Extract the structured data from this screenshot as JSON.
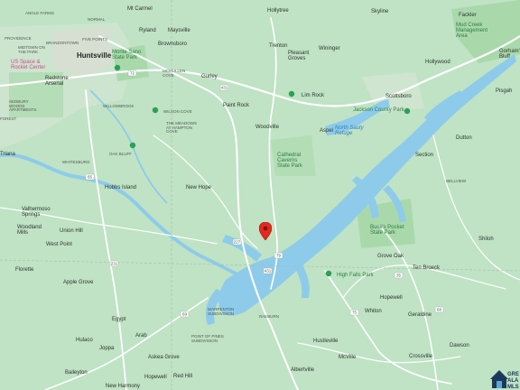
{
  "colors": {
    "land": "#bfe3c4",
    "land_light": "#cfead2",
    "water": "#8ecbea",
    "road": "#ffffff",
    "road_outline": "#9aa8a0",
    "park": "#a6d8a9",
    "urban": "#dcd6cc",
    "pin": "#e3291e"
  },
  "marker": {
    "icon": "map-pin-icon"
  },
  "labels": {
    "ardmore": "ANGLE FARMS",
    "mt_carmel": "Mt Carmel",
    "hollytree": "Hollytree",
    "skyline": "Skyline",
    "fackler": "Fackler",
    "mud_creek": "Mud Creek\nManagement\nArea",
    "gorhams_bluff": "Gorham's\nBluff",
    "ryland": "Ryland",
    "maysville": "Maysville",
    "normal": "NORMAL",
    "providence": "PROVIDENCE",
    "brandontown": "BRANDONTOWN",
    "midtown": "MIDTOWN ON\nTHE PARK",
    "five_points": "FIVE POINTS",
    "huntsville": "Huntsville",
    "monte_sano": "Monte Sano\nState Park",
    "brownsboro": "Brownsboro",
    "trenton": "Trenton",
    "wininger": "Wininger",
    "pleasant_groves": "Pleasant\nGroves",
    "hollywood": "Hollywood",
    "us_space": "US Space &\nRocket Center",
    "redstone": "Redstone\nArsenal",
    "mcmullen": "MCMULLEN\nCOVE",
    "gurley": "Gurley",
    "lim_rock": "Lim Rock",
    "scottsboro": "Scottsboro",
    "pisgah": "Pisgah",
    "sedbury": "SEDBURY\nWOODS\nAPARTMENTS",
    "willowbrook": "WILLOWBROOK",
    "paint_rock": "Paint Rock",
    "jackson_county_park": "Jackson County Park",
    "north_sauty": "North Sauty\nRefuge",
    "forest": "FOREST",
    "wilson_cove": "WILSON COVE",
    "meadows": "THE MEADOWS\nAT HAMPTON\nCOVE",
    "woodville": "Woodville",
    "aspel": "Aspel",
    "dutton": "Dutton",
    "oak_bluff": "OAK BLUFF",
    "cathedral": "Cathedral\nCaverns\nState Park",
    "section": "Section",
    "triana": "Triana",
    "whitesburg": "WHITESBURG",
    "bellview": "BELLVIEW",
    "hobbs_island": "Hobbs Island",
    "new_hope": "New Hope",
    "valhermoso": "Valhermoso\nSprings",
    "bucks_pocket": "Buck's Pocket\nState Park",
    "union_hill": "Union Hill",
    "shiloh": "Shiloh",
    "woodland_mills": "Woodland\nMills",
    "west_point": "West Point",
    "grove_oak": "Grove Oak",
    "ten_broeck": "Ten Broeck",
    "florette": "Florette",
    "high_falls": "High Falls Park",
    "apple_grove": "Apple Grove",
    "hopewell": "Hopewell",
    "guntersville_area": "WARRENTON\nSUBDIVISION",
    "whiton": "Whiton",
    "geraldine": "Geraldine",
    "egypt": "Egypt",
    "raeburn": "RAEBURN",
    "point_of_pines": "POINT OF PINES\nSUBDIVISION",
    "arab": "Arab",
    "hustleville": "Hustleville",
    "dawson": "Dawson",
    "hulaco": "Hulaco",
    "joppa": "Joppa",
    "askea_grove": "Askea Grove",
    "mcville": "McVille",
    "crossville": "Crossville",
    "baileyton": "Baileyton",
    "red_hill": "Red Hill",
    "hopewell2": "Hopewell",
    "albertville": "Albertville",
    "new_harmony": "New Harmony",
    "brand": "GRE\nALA\nMLS"
  },
  "route_shields": [
    "72",
    "431",
    "65",
    "231",
    "79",
    "35",
    "69",
    "227",
    "75",
    "431",
    "68"
  ]
}
